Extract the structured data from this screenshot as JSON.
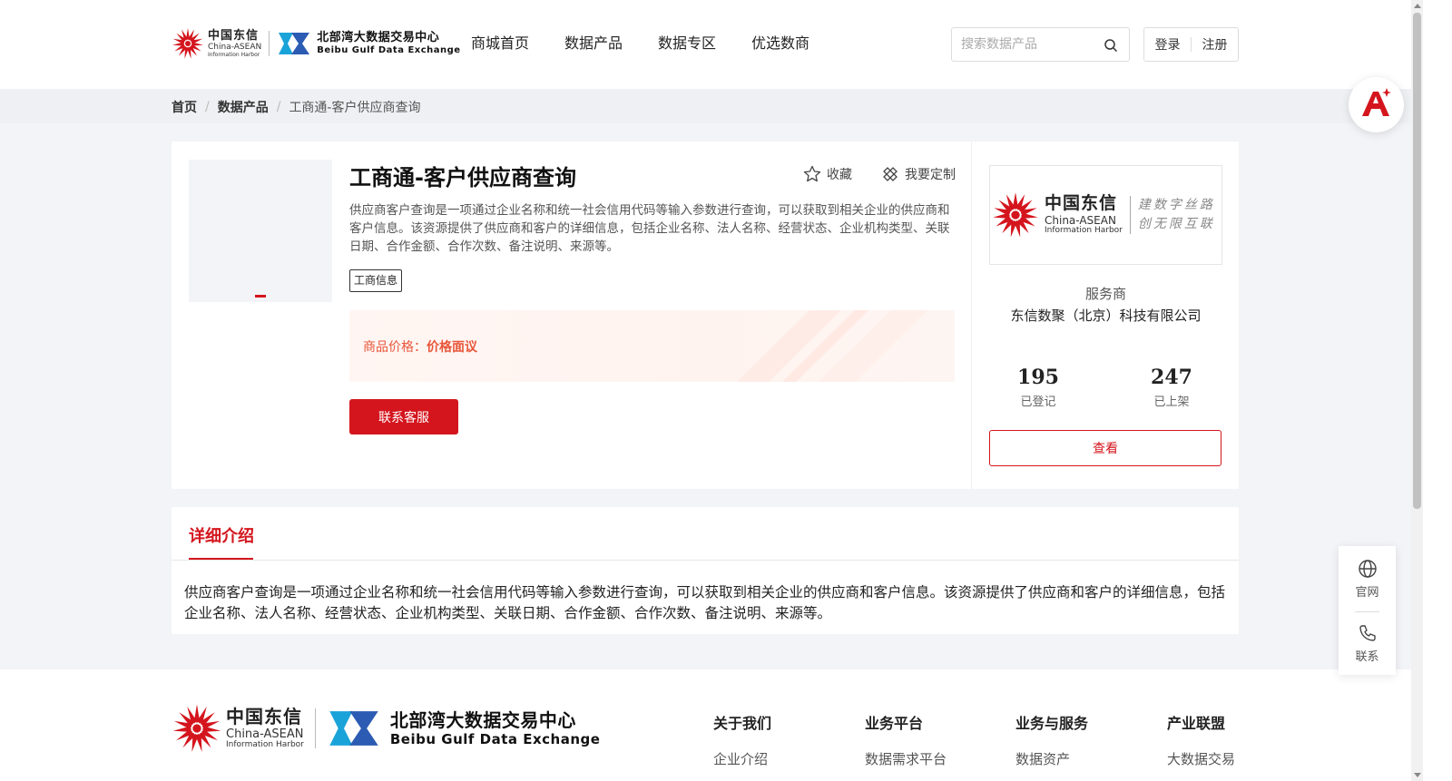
{
  "header": {
    "logo_cn": "中国东信",
    "logo_en1": "China-ASEAN",
    "logo_en2": "Information Harbor",
    "partner_cn": "北部湾大数据交易中心",
    "partner_en": "Beibu Gulf Data Exchange",
    "nav": [
      "商城首页",
      "数据产品",
      "数据专区",
      "优选数商"
    ],
    "search_placeholder": "搜索数据产品",
    "login": "登录",
    "register": "注册"
  },
  "breadcrumb": {
    "home": "首页",
    "category": "数据产品",
    "current": "工商通-客户供应商查询"
  },
  "product": {
    "title": "工商通-客户供应商查询",
    "favorite": "收藏",
    "customize": "我要定制",
    "description": "供应商客户查询是一项通过企业名称和统一社会信用代码等输入参数进行查询，可以获取到相关企业的供应商和客户信息。该资源提供了供应商和客户的详细信息，包括企业名称、法人名称、经营状态、企业机构类型、关联日期、合作金额、合作次数、备注说明、来源等。",
    "tag": "工商信息",
    "price_label": "商品价格：",
    "price_value": "价格面议",
    "contact_button": "联系客服"
  },
  "seller": {
    "logo_cn": "中国东信",
    "logo_en1": "China-ASEAN",
    "logo_en2": "Information Harbor",
    "slogan_line1": "建数字丝路",
    "slogan_line2": "创无限互联",
    "label": "服务商",
    "name": "东信数聚（北京）科技有限公司",
    "registered_count": "195",
    "registered_label": "已登记",
    "listed_count": "247",
    "listed_label": "已上架",
    "view_button": "查看"
  },
  "detail": {
    "tab": "详细介绍",
    "text": "供应商客户查询是一项通过企业名称和统一社会信用代码等输入参数进行查询，可以获取到相关企业的供应商和客户信息。该资源提供了供应商和客户的详细信息，包括企业名称、法人名称、经营状态、企业机构类型、关联日期、合作金额、合作次数、备注说明、来源等。"
  },
  "footer": {
    "columns": [
      {
        "heading": "关于我们",
        "item": "企业介绍"
      },
      {
        "heading": "业务平台",
        "item": "数据需求平台"
      },
      {
        "heading": "业务与服务",
        "item": "数据资产"
      },
      {
        "heading": "产业联盟",
        "item": "大数据交易"
      }
    ]
  },
  "floating": {
    "website": "官网",
    "contact": "联系"
  },
  "colors": {
    "accent": "#d4151d",
    "price": "#e8563a"
  }
}
